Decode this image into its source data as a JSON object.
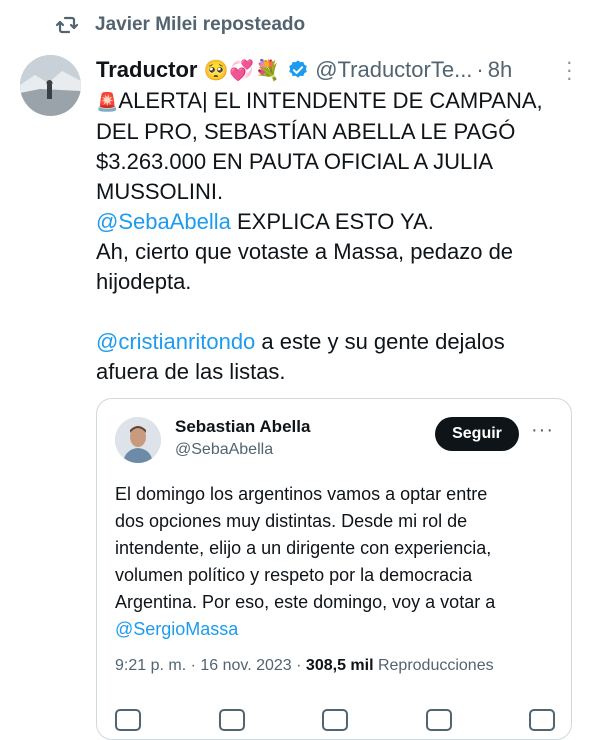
{
  "repost": {
    "label": "Javier Milei reposteado",
    "icon": "repost-icon"
  },
  "tweet": {
    "author_name": "Traductor",
    "author_emoji": "🥺💞💐",
    "author_handle": "@TraductorTe...",
    "separator": "·",
    "time": "8h",
    "line1_alarm": "🚨",
    "line1_rest": "ALERTA| EL INTENDENTE DE CAMPANA,",
    "line2": "DEL PRO,  SEBASTÍAN ABELLA LE PAGÓ",
    "line3": "$3.263.000 EN PAUTA OFICIAL A JULIA",
    "line4": "MUSSOLINI.",
    "line5_mention": "@SebaAbella",
    "line5_rest": " EXPLICA ESTO YA.",
    "line6": "Ah, cierto que votaste a Massa, pedazo de",
    "line7": "hijodepta.",
    "line8_mention": "@cristianritondo",
    "line8_rest": " a este y su gente dejalos",
    "line9": "afuera de las listas."
  },
  "quote": {
    "author_name": "Sebastian Abella",
    "author_handle": "@SebaAbella",
    "follow_label": "Seguir",
    "more_label": "···",
    "text_line1": "El domingo los argentinos vamos a optar entre",
    "text_line2": "dos opciones muy distintas. Desde mi rol de",
    "text_line3": "intendente, elijo a un dirigente con experiencia,",
    "text_line4": "volumen político y respeto por la democracia",
    "text_line5": "Argentina. Por eso, este domingo, voy a votar a",
    "text_mention": "@SergioMassa",
    "meta_datetime": "9:21 p. m. · 16 nov. 2023 · ",
    "meta_views": "308,5 mil",
    "meta_views_label": " Reproducciones"
  },
  "colors": {
    "link": "#1d9bf0",
    "muted": "#536471",
    "text": "#0f1419",
    "verified": "#1d9bf0"
  }
}
